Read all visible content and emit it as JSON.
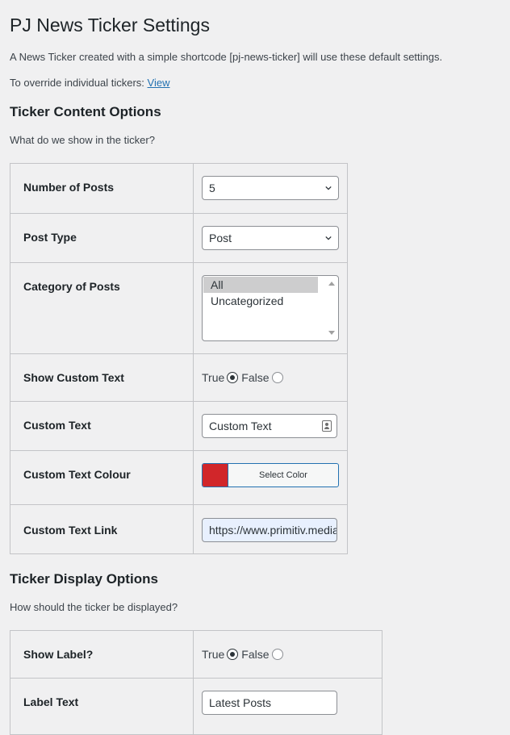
{
  "page": {
    "title": "PJ News Ticker Settings",
    "intro": "A News Ticker created with a simple shortcode [pj-news-ticker] will use these default settings.",
    "override_prefix": "To override individual tickers: ",
    "override_link": "View"
  },
  "content_section": {
    "title": "Ticker Content Options",
    "description": "What do we show in the ticker?",
    "fields": {
      "num_posts": {
        "label": "Number of Posts",
        "value": "5"
      },
      "post_type": {
        "label": "Post Type",
        "value": "Post"
      },
      "category": {
        "label": "Category of Posts",
        "options": [
          "All",
          "Uncategorized"
        ],
        "selected": "All"
      },
      "show_custom_text": {
        "label": "Show Custom Text",
        "true_label": "True",
        "false_label": "False",
        "value": "True"
      },
      "custom_text": {
        "label": "Custom Text",
        "value": "Custom Text"
      },
      "custom_text_colour": {
        "label": "Custom Text Colour",
        "button_label": "Select Color",
        "color": "#d1262a"
      },
      "custom_text_link": {
        "label": "Custom Text Link",
        "value": "https://www.primitiv.media/"
      }
    }
  },
  "display_section": {
    "title": "Ticker Display Options",
    "description": "How should the ticker be displayed?",
    "fields": {
      "show_label": {
        "label": "Show Label?",
        "true_label": "True",
        "false_label": "False",
        "value": "True"
      },
      "label_text": {
        "label": "Label Text",
        "value": "Latest Posts"
      }
    }
  },
  "icons": [
    "chevron-down-icon",
    "contact-card-icon",
    "scroll-up-arrow-icon",
    "scroll-down-arrow-icon"
  ],
  "colors": {
    "accent": "#2271b1",
    "border": "#c3c4c7",
    "background": "#f0f0f1"
  }
}
